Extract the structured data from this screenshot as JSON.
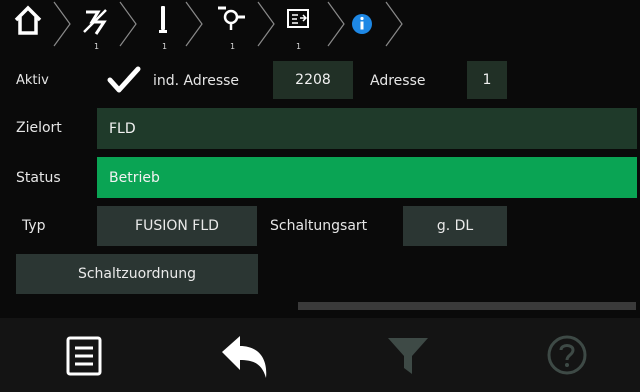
{
  "breadcrumb": [
    {
      "icon": "home-icon",
      "sub": ""
    },
    {
      "icon": "detector-off-icon",
      "sub": "1"
    },
    {
      "icon": "sensor-icon",
      "sub": "1"
    },
    {
      "icon": "branch-icon",
      "sub": "1"
    },
    {
      "icon": "module-icon",
      "sub": "1"
    },
    {
      "icon": "info-icon",
      "sub": ""
    }
  ],
  "row1": {
    "aktiv_label": "Aktiv",
    "ind_adresse_label": "ind. Adresse",
    "ind_adresse_value": "2208",
    "adresse_label": "Adresse",
    "adresse_value": "1"
  },
  "zielort": {
    "label": "Zielort",
    "value": "FLD"
  },
  "status": {
    "label": "Status",
    "value": "Betrieb"
  },
  "typ": {
    "label": "Typ",
    "value": "FUSION FLD",
    "schaltungsart_label": "Schaltungsart",
    "schaltungsart_value": "g. DL"
  },
  "schaltzuordnung": {
    "label": "Schaltzuordnung"
  },
  "toolbar": {
    "items": [
      "menu-icon",
      "back-arrow-icon",
      "filter-icon",
      "help-icon"
    ]
  },
  "colors": {
    "background": "#0a0a0a",
    "status_green": "#0aa454",
    "field_dark_green": "#1f3a2a",
    "info_blue": "#1e88e5"
  }
}
